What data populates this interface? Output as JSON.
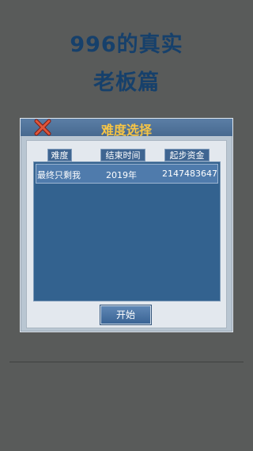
{
  "header": {
    "title_line1": "996的真实",
    "title_line2": "老板篇"
  },
  "dialog": {
    "title": "难度选择",
    "close_icon": "close-x-icon",
    "columns": [
      "难度",
      "结束时间",
      "起步资金"
    ],
    "rows": [
      {
        "difficulty": "最终只剩我",
        "end_time": "2019年",
        "start_funds": "2147483647"
      }
    ],
    "start_label": "开始"
  },
  "colors": {
    "background": "#595b5a",
    "title_text": "#16406b",
    "dialog_title": "#f7c545",
    "list_bg": "#33628f",
    "selected_row": "#4f7bac"
  }
}
